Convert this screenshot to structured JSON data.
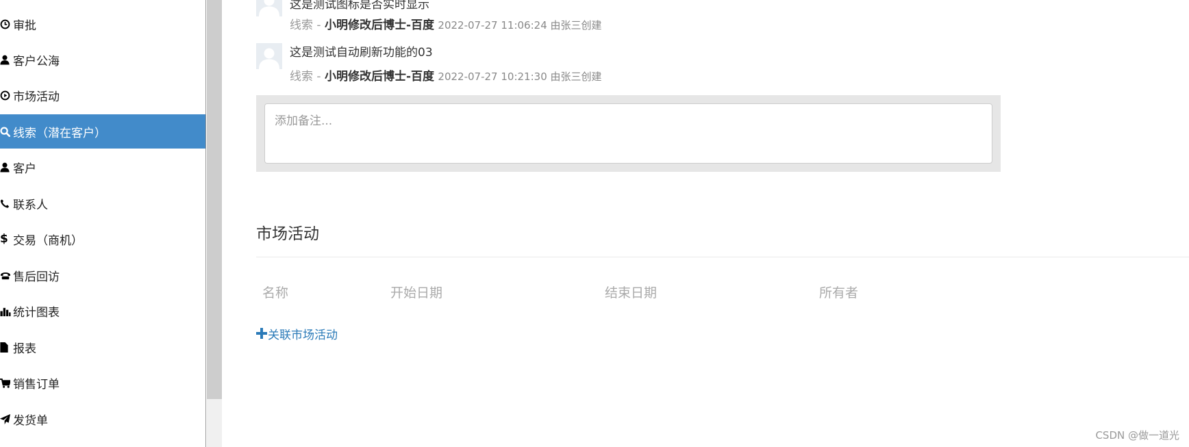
{
  "sidebar": {
    "items": [
      {
        "label": "审批",
        "icon": "clock-icon",
        "active": false
      },
      {
        "label": "客户公海",
        "icon": "user-icon",
        "active": false
      },
      {
        "label": "市场活动",
        "icon": "play-circle-icon",
        "active": false
      },
      {
        "label": "线索（潜在客户）",
        "icon": "search-icon",
        "active": true
      },
      {
        "label": "客户",
        "icon": "user-icon",
        "active": false
      },
      {
        "label": "联系人",
        "icon": "phone-icon",
        "active": false
      },
      {
        "label": "交易（商机）",
        "icon": "dollar-icon",
        "active": false
      },
      {
        "label": "售后回访",
        "icon": "phone-alt-icon",
        "active": false
      },
      {
        "label": "统计图表",
        "icon": "stats-icon",
        "active": false
      },
      {
        "label": "报表",
        "icon": "file-icon",
        "active": false
      },
      {
        "label": "销售订单",
        "icon": "shopping-cart-icon",
        "active": false
      },
      {
        "label": "发货单",
        "icon": "send-icon",
        "active": false
      }
    ]
  },
  "notes": [
    {
      "text": "这是测试图标是否实时显示",
      "type_label": "线索",
      "separator": " - ",
      "source": "小明修改后博士-百度",
      "time": "2022-07-27 11:06:24 由张三创建"
    },
    {
      "text": "这是测试自动刷新功能的03",
      "type_label": "线索",
      "separator": " - ",
      "source": "小明修改后博士-百度",
      "time": "2022-07-27 10:21:30 由张三创建"
    }
  ],
  "note_input": {
    "placeholder": "添加备注..."
  },
  "activity_section": {
    "title": "市场活动",
    "columns": [
      "名称",
      "开始日期",
      "结束日期",
      "所有者"
    ],
    "link_label": "关联市场活动"
  },
  "watermark": "CSDN @做一道光",
  "colors": {
    "accent": "#428bca",
    "link": "#2a7ab8"
  }
}
